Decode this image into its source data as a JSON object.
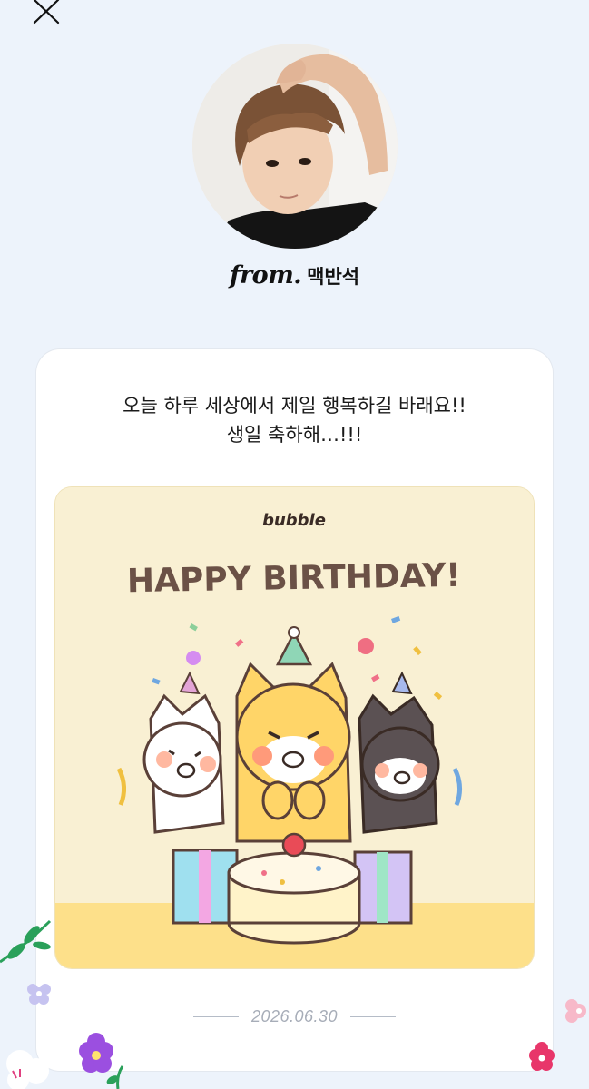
{
  "header": {
    "close_icon": "close-icon"
  },
  "sender": {
    "from_label": "from.",
    "name": "맥반석",
    "avatar": "profile-photo"
  },
  "letter": {
    "message_lines": [
      "오늘 하루 세상에서 제일 행복하길 바래요!!",
      "생일 축하해…!!!"
    ],
    "date": "2026.06.30"
  },
  "birthday_card": {
    "brand": "bubble",
    "headline": "HAPPY BIRTHDAY!",
    "background": "#f9f0d3",
    "text_color": "#6b5146"
  },
  "colors": {
    "page_background": "#edf3fb",
    "card_background": "#ffffff",
    "date_color": "#a7adb8"
  }
}
